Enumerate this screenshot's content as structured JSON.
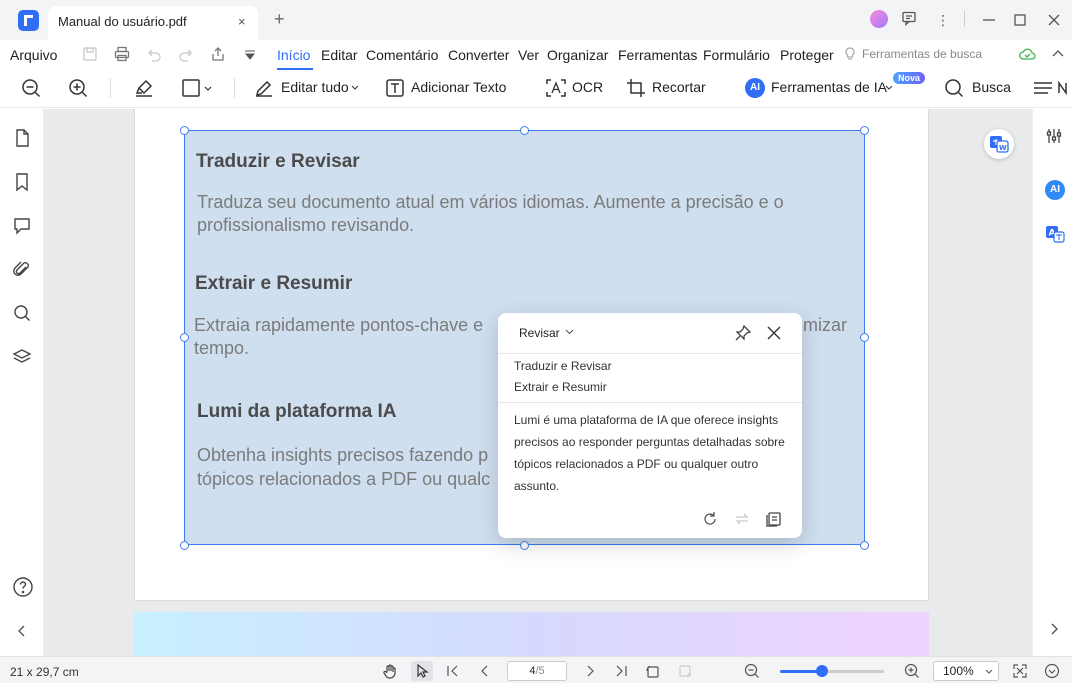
{
  "window": {
    "tab_title": "Manual do usuário.pdf",
    "close_tab": "×",
    "new_tab": "+"
  },
  "menu": {
    "file": "Arquivo",
    "items": [
      "Início",
      "Editar",
      "Comentário",
      "Converter",
      "Ver",
      "Organizar",
      "Ferramentas",
      "Formulário",
      "Proteger"
    ],
    "active_index": 0,
    "search_tools": "Ferramentas de busca"
  },
  "toolbar": {
    "edit_all": "Editar tudo",
    "add_text": "Adicionar Texto",
    "ocr": "OCR",
    "crop": "Recortar",
    "ai_tools": "Ferramentas de IA",
    "nova_badge": "Nova",
    "search": "Busca"
  },
  "document": {
    "sections": [
      {
        "heading": "Traduzir e Revisar",
        "body": "Traduza seu documento atual em vários idiomas. Aumente a precisão e o profissionalismo revisando."
      },
      {
        "heading": "Extrair e Resumir",
        "body_line1": "Extraia rapidamente pontos-chave e",
        "body_line1_tail": "mizar",
        "body_line2": "tempo."
      },
      {
        "heading": "Lumi da plataforma IA",
        "body_line1": "Obtenha insights precisos fazendo p",
        "body_line2": "tópicos relacionados a PDF ou qualc"
      }
    ]
  },
  "ai_popup": {
    "mode": "Revisar",
    "options": [
      "Traduzir e Revisar",
      "Extrair e Resumir"
    ],
    "body": "Lumi é uma plataforma de IA que oferece insights precisos ao responder perguntas detalhadas sobre tópicos relacionados a PDF ou qualquer outro assunto."
  },
  "status": {
    "page_size": "21 x 29,7 cm",
    "current_page": "4",
    "total_pages": "/5",
    "zoom": "100%"
  },
  "colors": {
    "accent": "#2f6ef5",
    "selection_fill": "#cfdff0",
    "selection_border": "#3e7cf0"
  }
}
